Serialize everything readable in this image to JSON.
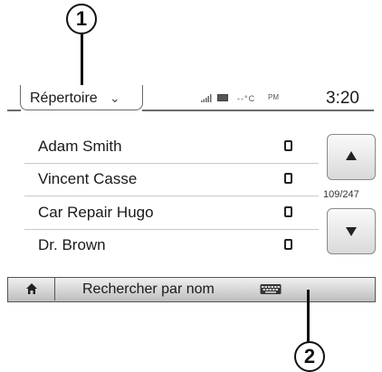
{
  "callouts": {
    "top": "1",
    "bottom": "2"
  },
  "header": {
    "title": "Répertoire",
    "title_icon": "chevron-down-icon",
    "status": {
      "signal_icon": "signal-bars-icon",
      "battery_icon": "battery-icon",
      "temperature": "--°C",
      "meridiem": "PM"
    },
    "clock": "3:20"
  },
  "contacts": [
    {
      "name": "Adam Smith",
      "icon": "mobile-phone-icon"
    },
    {
      "name": "Vincent Casse",
      "icon": "mobile-phone-icon"
    },
    {
      "name": "Car Repair Hugo",
      "icon": "mobile-phone-icon"
    },
    {
      "name": "Dr. Brown",
      "icon": "mobile-phone-icon"
    }
  ],
  "scroll": {
    "counter": "109/247",
    "up_icon": "arrow-up-icon",
    "down_icon": "arrow-down-icon"
  },
  "bottom_bar": {
    "home_icon": "home-icon",
    "search_label": "Rechercher par nom",
    "keyboard_icon": "keyboard-icon"
  }
}
